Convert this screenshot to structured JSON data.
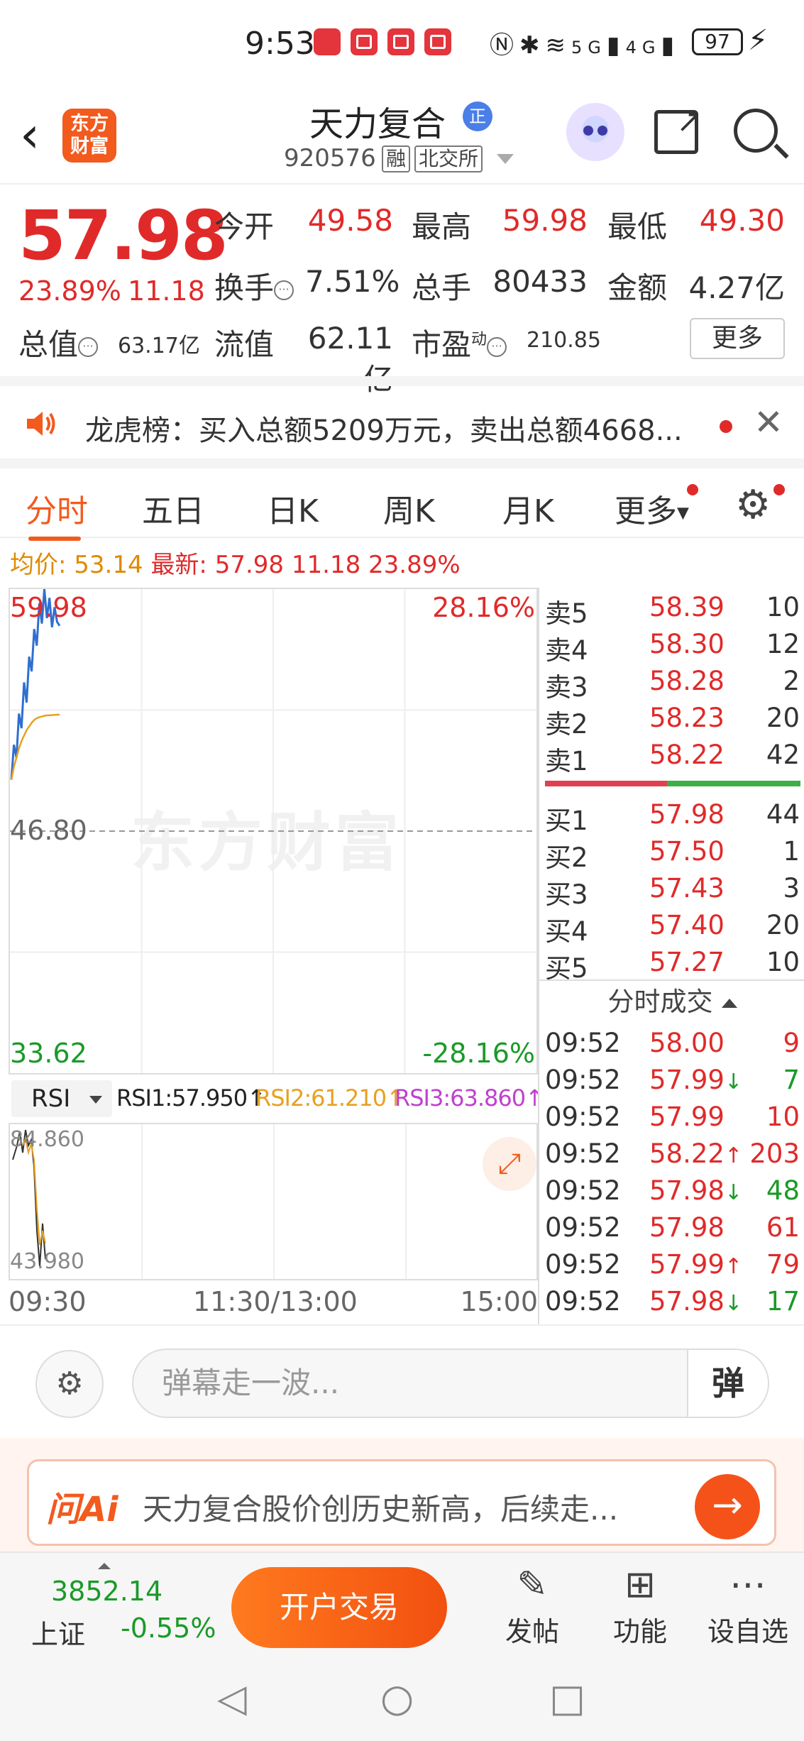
{
  "status": {
    "time": "9:53",
    "network": "5G",
    "network2": "4G",
    "battery": "97"
  },
  "header": {
    "stock_name": "天力复合",
    "name_badge": "正",
    "stock_code": "920576",
    "tag_margin": "融",
    "tag_exchange": "北交所",
    "logo_text_1": "东方",
    "logo_text_2": "财富"
  },
  "quote": {
    "price": "57.98",
    "change_pct": "23.89%",
    "change_amt": "11.18",
    "open_label": "今开",
    "open": "49.58",
    "high_label": "最高",
    "high": "59.98",
    "low_label": "最低",
    "low": "49.30",
    "turnover_label": "换手",
    "turnover": "7.51%",
    "volume_label": "总手",
    "volume": "80433",
    "amount_label": "金额",
    "amount": "4.27亿",
    "mktcap_label": "总值",
    "mktcap": "63.17亿",
    "float_label": "流值",
    "float_cap": "62.11亿",
    "pe_label": "市盈",
    "pe_sup": "动",
    "pe": "210.85",
    "more": "更多"
  },
  "notice": {
    "text": "龙虎榜：买入总额5209万元，卖出总额4668..."
  },
  "tabs": [
    {
      "label": "分时"
    },
    {
      "label": "五日"
    },
    {
      "label": "日K"
    },
    {
      "label": "周K"
    },
    {
      "label": "月K"
    },
    {
      "label": "更多"
    }
  ],
  "avgline": {
    "avg_label": "均价:",
    "avg": "53.14",
    "last_label": "最新:",
    "last": "57.98",
    "chg": "11.18",
    "pct": "23.89%"
  },
  "chart": {
    "watermark": "东方财富",
    "top_price": "59.98",
    "top_pct": "28.16%",
    "mid_price": "46.80",
    "bottom_price": "33.62",
    "bottom_pct": "-28.16%",
    "time_start": "09:30",
    "time_mid": "11:30/13:00",
    "time_end": "15:00",
    "colors": {
      "price_line": "#2f6fd0",
      "avg_line": "#e8a020"
    }
  },
  "chart_data": {
    "type": "line",
    "title": "",
    "ylim": [
      33.62,
      59.98
    ],
    "xlim": [
      "09:30",
      "15:00"
    ],
    "series": [
      {
        "values": [
          49.6,
          51.5,
          50.8,
          53.2,
          52.4,
          54.9,
          53.8,
          56.3,
          55.5,
          57.8,
          56.9,
          59.2,
          58.1,
          59.98,
          58.4,
          59.5,
          57.9,
          59.0,
          58.2,
          57.98
        ]
      },
      {
        "values": [
          49.6,
          50.3,
          50.8,
          51.3,
          51.7,
          52.0,
          52.3,
          52.5,
          52.7,
          52.85,
          52.95,
          53.0,
          53.04,
          53.08,
          53.1,
          53.11,
          53.12,
          53.13,
          53.14,
          53.14
        ]
      }
    ]
  },
  "rsi": {
    "selector": "RSI",
    "rsi1": "RSI1:57.950",
    "rsi2": "RSI2:61.210",
    "rsi3": "RSI3:63.860",
    "top_val": "84.860",
    "bottom_val": "43.980",
    "colors": {
      "rsi1": "#222222",
      "rsi2": "#e8a020",
      "rsi3": "#c040d0"
    }
  },
  "orderbook": {
    "asks": [
      {
        "label": "卖5",
        "price": "58.39",
        "vol": "10"
      },
      {
        "label": "卖4",
        "price": "58.30",
        "vol": "12"
      },
      {
        "label": "卖3",
        "price": "58.28",
        "vol": "2"
      },
      {
        "label": "卖2",
        "price": "58.23",
        "vol": "20"
      },
      {
        "label": "卖1",
        "price": "58.22",
        "vol": "42"
      }
    ],
    "bids": [
      {
        "label": "买1",
        "price": "57.98",
        "vol": "44"
      },
      {
        "label": "买2",
        "price": "57.50",
        "vol": "1"
      },
      {
        "label": "买3",
        "price": "57.43",
        "vol": "3"
      },
      {
        "label": "买4",
        "price": "57.40",
        "vol": "20"
      },
      {
        "label": "买5",
        "price": "57.27",
        "vol": "10"
      }
    ],
    "trades_title": "分时成交",
    "trades": [
      {
        "time": "09:52",
        "price": "58.00",
        "dir": "",
        "vol": "9",
        "side": "red"
      },
      {
        "time": "09:52",
        "price": "57.99",
        "dir": "↓",
        "vol": "7",
        "side": "green"
      },
      {
        "time": "09:52",
        "price": "57.99",
        "dir": "",
        "vol": "10",
        "side": "red"
      },
      {
        "time": "09:52",
        "price": "58.22",
        "dir": "↑",
        "vol": "203",
        "side": "red"
      },
      {
        "time": "09:52",
        "price": "57.98",
        "dir": "↓",
        "vol": "48",
        "side": "green"
      },
      {
        "time": "09:52",
        "price": "57.98",
        "dir": "",
        "vol": "61",
        "side": "red"
      },
      {
        "time": "09:52",
        "price": "57.99",
        "dir": "↑",
        "vol": "79",
        "side": "red"
      },
      {
        "time": "09:52",
        "price": "57.98",
        "dir": "↓",
        "vol": "17",
        "side": "green"
      }
    ]
  },
  "danmaku": {
    "placeholder": "弹幕走一波...",
    "send": "弹"
  },
  "ai": {
    "logo": "问Ai",
    "text": "天力复合股价创历史新高，后续走..."
  },
  "bottom": {
    "index_value": "3852.14",
    "index_name": "上证",
    "index_pct": "-0.55%",
    "trade_button": "开户交易",
    "post": "发帖",
    "functions": "功能",
    "add_watch": "设自选"
  }
}
